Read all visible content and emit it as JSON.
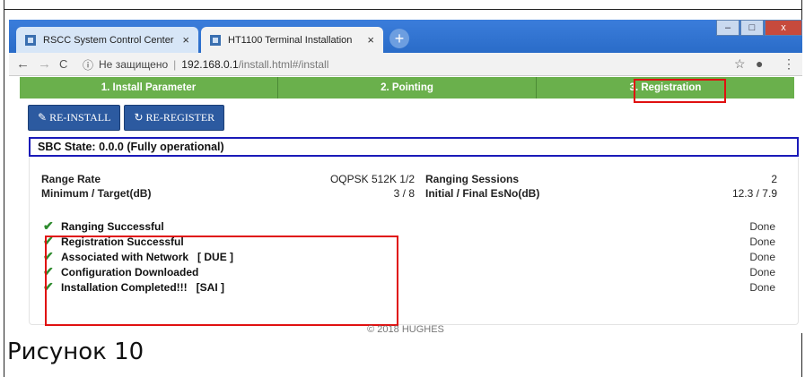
{
  "browser": {
    "tabs": [
      {
        "title": "RSCC System Control Center",
        "close": "×"
      },
      {
        "title": "HT1100 Terminal Installation",
        "close": "×"
      }
    ],
    "new_tab": "+",
    "window_buttons": [
      "–",
      "□",
      "x"
    ],
    "nav": {
      "back": "←",
      "forward": "→",
      "reload": "C",
      "info": "ⓘ"
    },
    "security_label": "Не защищено",
    "url_host": "192.168.0.1",
    "url_path": "/install.html#/install",
    "star": "☆",
    "menu": "⋮"
  },
  "steps": [
    "1. Install Parameter",
    "2. Pointing",
    "3. Registration"
  ],
  "buttons": {
    "reinstall": "RE-INSTALL",
    "reregister": "RE-REGISTER"
  },
  "sbc_state": "SBC State: 0.0.0 (Fully operational)",
  "stats": {
    "range_rate_label": "Range Rate",
    "range_rate_value": "OQPSK 512K 1/2",
    "ranging_sessions_label": "Ranging Sessions",
    "ranging_sessions_value": "2",
    "min_target_label": "Minimum / Target(dB)",
    "min_target_value": "3 / 8",
    "esno_label": "Initial / Final EsNo(dB)",
    "esno_value": "12.3 / 7.9"
  },
  "checks": [
    {
      "label": "Ranging Successful",
      "extra": "",
      "status": "Done"
    },
    {
      "label": "Registration Successful",
      "extra": "",
      "status": "Done"
    },
    {
      "label": "Associated with Network",
      "extra": "[ DUE ]",
      "status": "Done"
    },
    {
      "label": "Configuration Downloaded",
      "extra": "",
      "status": "Done"
    },
    {
      "label": "Installation Completed!!!",
      "extra": "[SAI ]",
      "status": "Done"
    }
  ],
  "footer": "© 2018 HUGHES",
  "caption": "Рисунок 10",
  "colors": {
    "step_bar": "#6ab04c",
    "button": "#2c5aa0",
    "highlight": "#e01010",
    "sbc_border": "#1a1ab8"
  }
}
